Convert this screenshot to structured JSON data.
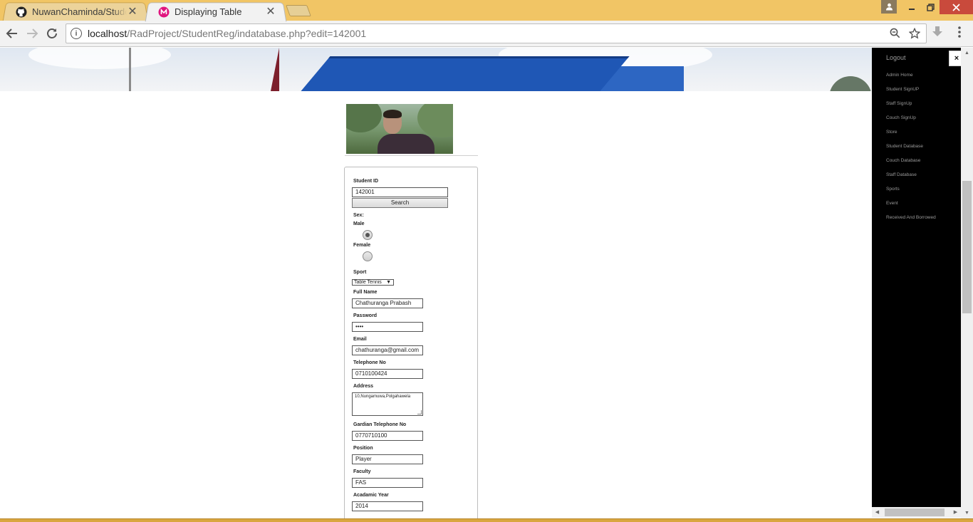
{
  "browser": {
    "tabs": [
      {
        "title": "NuwanChaminda/Studen",
        "active": false,
        "icon": "github-icon"
      },
      {
        "title": "Displaying Table",
        "active": true,
        "icon": "site-favicon-icon"
      }
    ],
    "close_glyph": "✕",
    "url": {
      "host": "localhost",
      "path": "/RadProject/StudentReg/indatabase.php?edit=142001"
    },
    "colors": {
      "titlebar": "#f1c565",
      "close_button": "#c94a3c"
    }
  },
  "sidebar": {
    "logout_label": "Logout",
    "close_glyph": "×",
    "items": [
      {
        "label": "Admin Home"
      },
      {
        "label": "Student SignUP"
      },
      {
        "label": "Staff SignUp"
      },
      {
        "label": "Couch SignUp"
      },
      {
        "label": "Store"
      },
      {
        "label": "Student Database"
      },
      {
        "label": "Couch Database"
      },
      {
        "label": "Staff Database"
      },
      {
        "label": "Sports"
      },
      {
        "label": "Event"
      },
      {
        "label": "Received And Borrowed"
      }
    ]
  },
  "form": {
    "student_id": {
      "label": "Student ID",
      "value": "142001"
    },
    "search_button": "Search",
    "sex": {
      "label": "Sex:",
      "options": [
        {
          "label": "Male",
          "checked": true
        },
        {
          "label": "Female",
          "checked": false
        }
      ]
    },
    "sport": {
      "label": "Sport",
      "selected": "Table Tennis"
    },
    "full_name": {
      "label": "Full Name",
      "value": "Chathuranga Prabash"
    },
    "password": {
      "label": "Password",
      "value": "••••"
    },
    "email": {
      "label": "Email",
      "value": "chathuranga@gmail.com"
    },
    "telephone": {
      "label": "Telephone No",
      "value": "0710100424"
    },
    "address": {
      "label": "Address",
      "value": "10,Nungamuwa,Polgahawela"
    },
    "guardian_telephone": {
      "label": "Gardian Telephone No",
      "value": "0770710100"
    },
    "position": {
      "label": "Position",
      "value": "Player"
    },
    "faculty": {
      "label": "Faculty",
      "value": "FAS"
    },
    "academic_year": {
      "label": "Acadamic Year",
      "value": "2014"
    }
  }
}
